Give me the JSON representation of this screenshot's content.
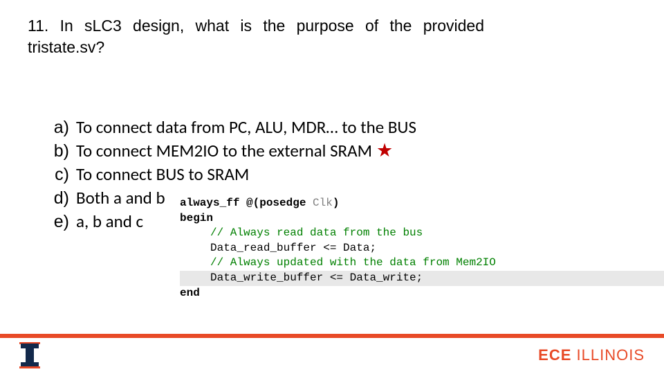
{
  "question": "11.  In sLC3 design, what is the purpose of the provided tristate.sv?",
  "answers": [
    {
      "letter": "a)",
      "text": "To connect data from PC, ALU, MDR… to the BUS",
      "correct": false
    },
    {
      "letter": "b)",
      "text": "To connect MEM2IO to the external SRAM",
      "correct": true
    },
    {
      "letter": "c)",
      "text": "To connect BUS to SRAM",
      "correct": false
    },
    {
      "letter": "d)",
      "text": "Both a and b",
      "correct": false
    },
    {
      "letter": "e)",
      "text": "a, b and c",
      "correct": false
    }
  ],
  "star_glyph": "★",
  "code": {
    "l1a": "always_ff @(posedge ",
    "l1b": "Clk",
    "l1c": ")",
    "l2": "begin",
    "l3": "// Always read data from the bus",
    "l4": "Data_read_buffer <= Data;",
    "l5": "// Always updated with the data from Mem2IO",
    "l6": "Data_write_buffer <= Data_write;",
    "l7": "end"
  },
  "footer": {
    "ece": "ECE",
    "illinois": " ILLINOIS"
  }
}
